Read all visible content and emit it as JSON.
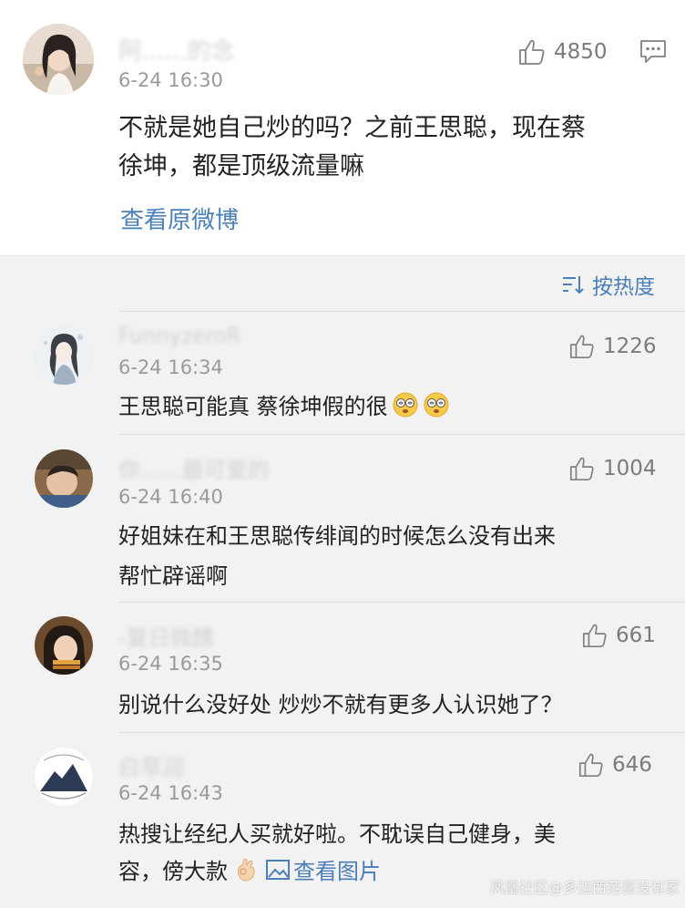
{
  "main_comment": {
    "username": "阿......的念",
    "time": "6-24 16:30",
    "likes": "4850",
    "text_line1": "不就是她自己炒的吗？之前王思聪，现在蔡",
    "text_line2": "徐坤，都是顶级流量嘛",
    "view_original": "查看原微博"
  },
  "sort": {
    "label": "按热度"
  },
  "replies": [
    {
      "username": "FunnyzeroR",
      "time": "6-24 16:34",
      "likes": "1226",
      "text_line1": "王思聪可能真 蔡徐坤假的很",
      "text_line2": ""
    },
    {
      "username": "你......最可爱的",
      "time": "6-24 16:40",
      "likes": "1004",
      "text_line1": "好姐妹在和王思聪传绯闻的时候怎么没有出来",
      "text_line2": "帮忙辟谣啊"
    },
    {
      "username": "-夏日微醺",
      "time": "6-24 16:35",
      "likes": "661",
      "text_line1": "别说什么没好处 炒炒不就有更多人认识她了？",
      "text_line2": ""
    },
    {
      "username": "白草润",
      "time": "6-24 16:43",
      "likes": "646",
      "text_line1": "热搜让经纪人买就好啦。不耽误自己健身，美",
      "text_line2": "容，傍大款",
      "view_image": "查看图片"
    }
  ],
  "watermark": "凤凰社区@多边西范喜没有家",
  "colors": {
    "link_blue": "#4a7fb8",
    "meta_gray": "#9a9a9a",
    "bg_gray": "#f2f2f2"
  }
}
